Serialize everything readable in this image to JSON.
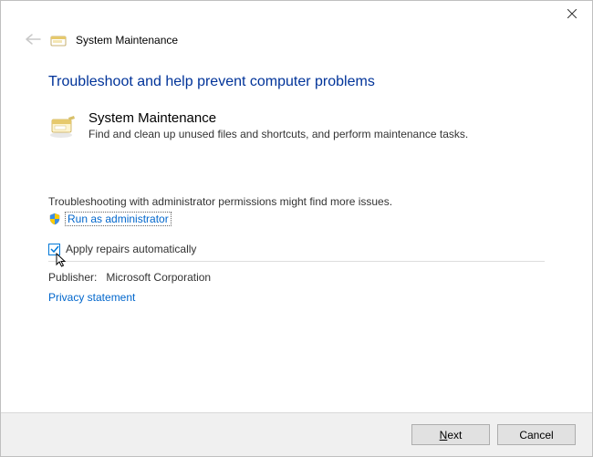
{
  "titlebar": {
    "page_title": "System Maintenance"
  },
  "main": {
    "heading": "Troubleshoot and help prevent computer problems",
    "section_title": "System Maintenance",
    "section_desc": "Find and clean up unused files and shortcuts, and perform maintenance tasks."
  },
  "admin": {
    "note": "Troubleshooting with administrator permissions might find more issues.",
    "link": "Run as administrator"
  },
  "checkbox": {
    "label": "Apply repairs automatically",
    "checked": true
  },
  "publisher": {
    "label": "Publisher:",
    "value": "Microsoft Corporation"
  },
  "privacy": {
    "label": "Privacy statement"
  },
  "footer": {
    "next_accesskey": "N",
    "next_rest": "ext",
    "cancel": "Cancel"
  }
}
